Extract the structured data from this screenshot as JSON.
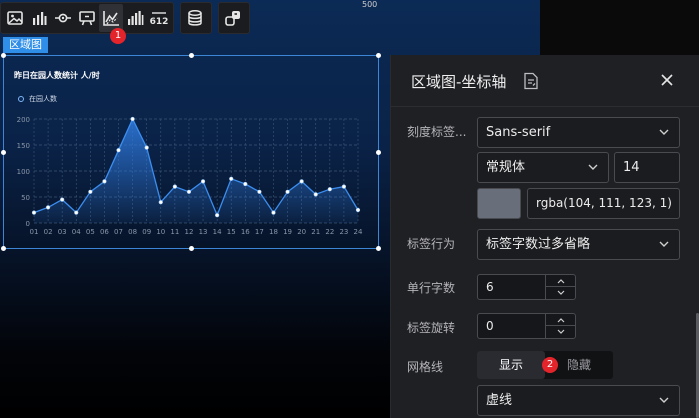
{
  "canvas": {
    "ruler_label": "500"
  },
  "toolbar": {
    "icons": [
      "image-icon",
      "bar-chart-icon",
      "node-icon",
      "screen-comment-icon",
      "area-chart-icon",
      "column-chart-icon",
      "number-counter-icon",
      "database-icon",
      "link-icon"
    ],
    "number_counter_text": "612",
    "badge_1": "1"
  },
  "widget": {
    "tag": "区域图",
    "title": "昨日在园人数统计 人/时",
    "legend": "在园人数"
  },
  "chart_data": {
    "type": "area",
    "title": "昨日在园人数统计 人/时",
    "categories": [
      "01",
      "02",
      "03",
      "04",
      "05",
      "06",
      "07",
      "08",
      "09",
      "10",
      "11",
      "12",
      "13",
      "14",
      "15",
      "16",
      "17",
      "18",
      "19",
      "20",
      "21",
      "22",
      "23",
      "24"
    ],
    "series": [
      {
        "name": "在园人数",
        "values": [
          20,
          30,
          45,
          20,
          60,
          80,
          140,
          200,
          145,
          40,
          70,
          60,
          80,
          15,
          85,
          75,
          60,
          20,
          60,
          80,
          55,
          65,
          70,
          25
        ]
      }
    ],
    "yticks": [
      0,
      50,
      100,
      150,
      200
    ],
    "ylim": [
      0,
      200
    ],
    "grid": "dashed",
    "legend_position": "top-left",
    "colors": {
      "line": "#3b8ef0",
      "area_top": "#2f7be0",
      "grid": "#3b5676",
      "tick": "#8a96a8"
    }
  },
  "panel": {
    "title": "区域图-坐标轴",
    "rows": {
      "tick_label": {
        "label": "刻度标签...",
        "font_family": "Sans-serif",
        "font_weight": "常规体",
        "font_size": "14",
        "color_value": "rgba(104, 111, 123, 1)",
        "swatch_color": "#686f7b"
      },
      "label_behavior": {
        "label": "标签行为",
        "value": "标签字数过多省略"
      },
      "chars_per_line": {
        "label": "单行字数",
        "value": "6"
      },
      "label_rotation": {
        "label": "标签旋转",
        "value": "0"
      },
      "grid_line": {
        "label": "网格线",
        "show": "显示",
        "hide": "隐藏",
        "style": "虚线"
      }
    },
    "badge_2": "2"
  }
}
